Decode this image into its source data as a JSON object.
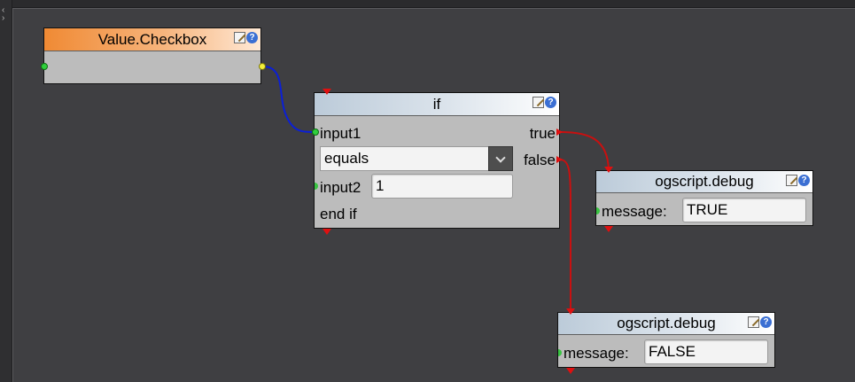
{
  "nodes": {
    "checkbox": {
      "title": "Value.Checkbox"
    },
    "if": {
      "title": "if",
      "input1_label": "input1",
      "true_label": "true",
      "false_label": "false",
      "operator": "equals",
      "input2_label": "input2",
      "input2_value": "1",
      "end_label": "end if"
    },
    "debug_true": {
      "title": "ogscript.debug",
      "message_label": "message:",
      "message_value": "TRUE"
    },
    "debug_false": {
      "title": "ogscript.debug",
      "message_label": "message:",
      "message_value": "FALSE"
    }
  },
  "icons": {
    "edit": "edit-icon",
    "help": "help-icon",
    "collapse": "collapse-icon"
  },
  "colors": {
    "canvas": "#3f3f42",
    "node_body": "#bcbcbc",
    "value_header": "#f08a34",
    "logic_header": "#bccbd9",
    "wire_data": "#0b1fd6",
    "wire_flow": "#c81010",
    "port_in": "#2fcf3c",
    "port_out": "#f3ef3a"
  }
}
